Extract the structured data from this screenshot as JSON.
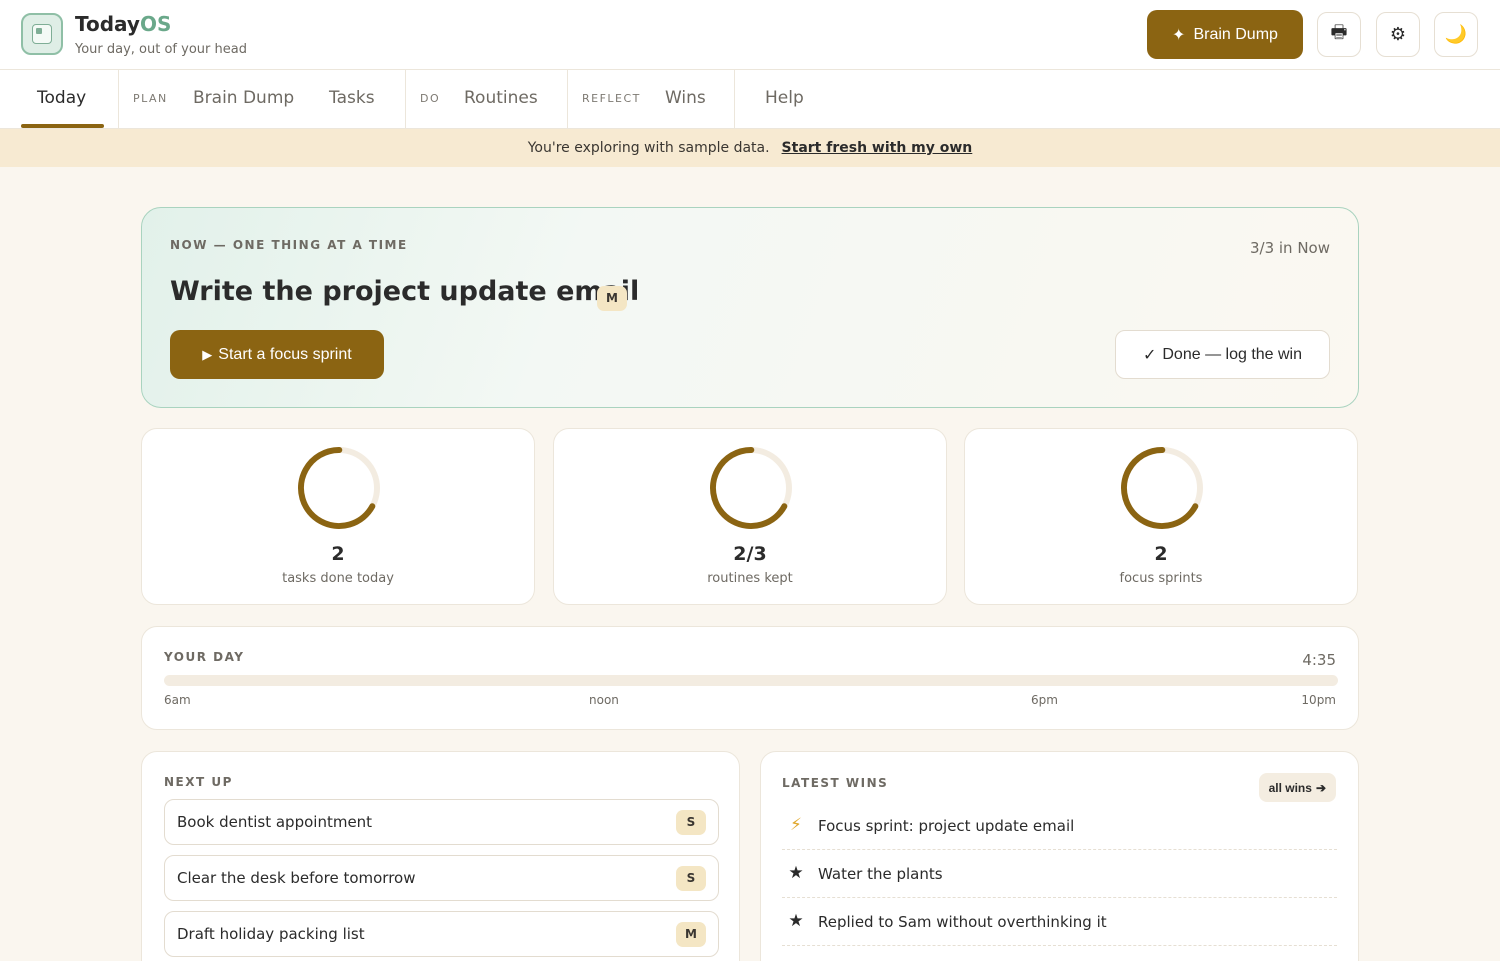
{
  "app": {
    "name": "Today",
    "name_suffix": "OS",
    "tagline": "Your day, out of your head"
  },
  "header": {
    "brain_dump_label": "Brain Dump",
    "brain_dump_icon": "✦",
    "printer_icon": "🖶",
    "settings_icon": "⚙",
    "theme_icon": "🌙"
  },
  "nav": {
    "today": "Today",
    "plan_group": "PLAN",
    "brain_dump": "Brain Dump",
    "tasks": "Tasks",
    "do_group": "DO",
    "routines": "Routines",
    "reflect_group": "REFLECT",
    "wins": "Wins",
    "help": "Help"
  },
  "banner": {
    "text": "You're exploring with sample data.",
    "link": "Start fresh with my own"
  },
  "now": {
    "label": "NOW — ONE THING AT A TIME",
    "count": "3/3 in Now",
    "title": "Write the project update email",
    "size": "M",
    "focus_label": "Start a focus sprint",
    "focus_icon": "▶",
    "done_label": "Done — log the win",
    "done_icon": "✓"
  },
  "stats": [
    {
      "value": "2",
      "label": "tasks done today",
      "fraction": 0.67
    },
    {
      "value": "2/3",
      "label": "routines kept",
      "fraction": 0.67
    },
    {
      "value": "2",
      "label": "focus sprints",
      "fraction": 0.67
    }
  ],
  "day": {
    "label": "YOUR DAY",
    "time": "4:35",
    "progress": 0,
    "ticks": [
      "6am",
      "noon",
      "6pm",
      "10pm"
    ]
  },
  "next_up": {
    "label": "NEXT UP",
    "tasks": [
      {
        "title": "Book dentist appointment",
        "size": "S"
      },
      {
        "title": "Clear the desk before tomorrow",
        "size": "S"
      },
      {
        "title": "Draft holiday packing list",
        "size": "M"
      }
    ]
  },
  "wins": {
    "label": "LATEST WINS",
    "all_label": "all wins",
    "all_icon": "➔",
    "items": [
      {
        "icon": "⚡",
        "text": "Focus sprint: project update email"
      },
      {
        "icon": "★",
        "text": "Water the plants"
      },
      {
        "icon": "★",
        "text": "Replied to Sam without overthinking it"
      }
    ]
  },
  "colors": {
    "accent": "#8b6412",
    "mint_border": "#a9d3bf",
    "background": "#faf6ef",
    "banner": "#f7ead2",
    "badge": "#f4e6c4"
  }
}
